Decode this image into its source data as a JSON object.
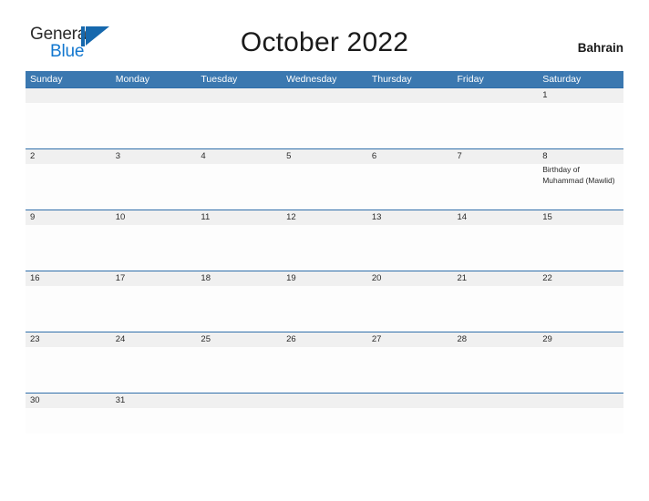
{
  "brand": {
    "word_one": "General",
    "word_two": "Blue",
    "mark_icon": "sail-flag-icon",
    "accent_color": "#1277cf",
    "mark_color": "#1668ad"
  },
  "header": {
    "title": "October 2022",
    "country": "Bahrain"
  },
  "calendar": {
    "header_bg": "#3b78b0",
    "rule_color": "#2f6eaa",
    "number_band_bg": "#f0f0f0",
    "day_names": [
      "Sunday",
      "Monday",
      "Tuesday",
      "Wednesday",
      "Thursday",
      "Friday",
      "Saturday"
    ],
    "weeks": [
      {
        "numbers": [
          "",
          "",
          "",
          "",
          "",
          "",
          "1"
        ],
        "events": [
          "",
          "",
          "",
          "",
          "",
          "",
          ""
        ]
      },
      {
        "numbers": [
          "2",
          "3",
          "4",
          "5",
          "6",
          "7",
          "8"
        ],
        "events": [
          "",
          "",
          "",
          "",
          "",
          "",
          "Birthday of Muhammad (Mawlid)"
        ]
      },
      {
        "numbers": [
          "9",
          "10",
          "11",
          "12",
          "13",
          "14",
          "15"
        ],
        "events": [
          "",
          "",
          "",
          "",
          "",
          "",
          ""
        ]
      },
      {
        "numbers": [
          "16",
          "17",
          "18",
          "19",
          "20",
          "21",
          "22"
        ],
        "events": [
          "",
          "",
          "",
          "",
          "",
          "",
          ""
        ]
      },
      {
        "numbers": [
          "23",
          "24",
          "25",
          "26",
          "27",
          "28",
          "29"
        ],
        "events": [
          "",
          "",
          "",
          "",
          "",
          "",
          ""
        ]
      },
      {
        "numbers": [
          "30",
          "31",
          "",
          "",
          "",
          "",
          ""
        ],
        "events": [
          "",
          "",
          "",
          "",
          "",
          "",
          ""
        ]
      }
    ]
  }
}
